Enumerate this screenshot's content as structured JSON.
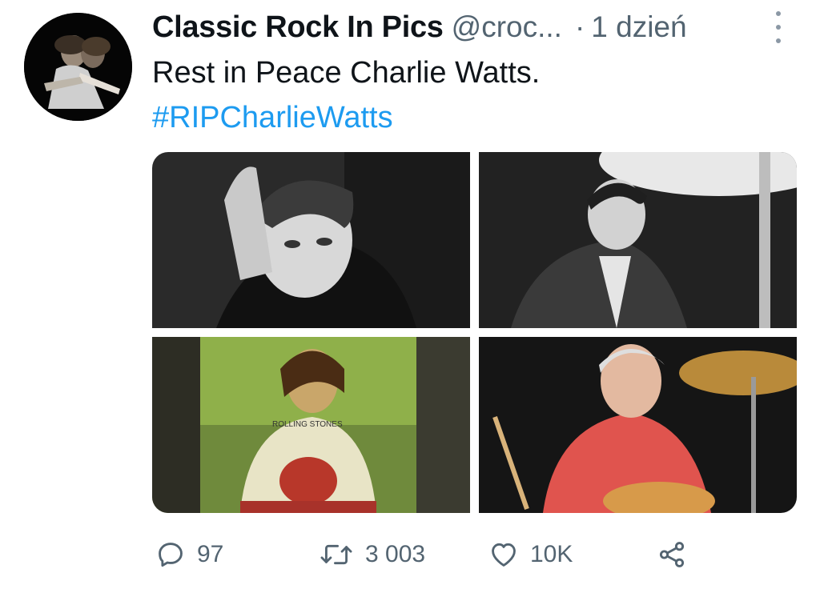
{
  "tweet": {
    "author_name": "Classic Rock In Pics",
    "author_handle": "@croc...",
    "separator": "·",
    "time": "1 dzień",
    "text": "Rest in Peace Charlie Watts.",
    "hashtag": "#RIPCharlieWatts",
    "photo_text": "ROLLING STONES"
  },
  "actions": {
    "reply_count": "97",
    "retweet_count": "3 003",
    "like_count": "10K"
  },
  "icons": {
    "reply": "reply-icon",
    "retweet": "retweet-icon",
    "like": "heart-icon",
    "share": "share-icon",
    "more": "more-icon"
  },
  "colors": {
    "link": "#1d9bf0",
    "muted": "#536471",
    "text": "#0f1419"
  }
}
